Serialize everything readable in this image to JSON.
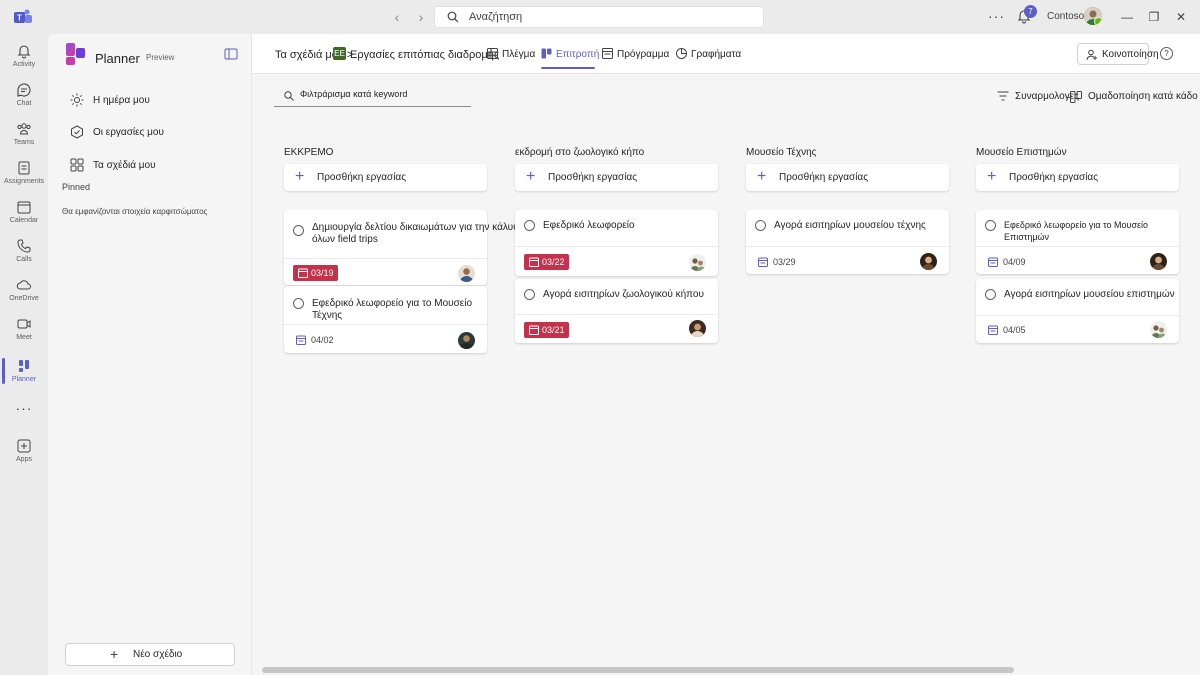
{
  "titlebar": {
    "search_placeholder": "Αναζήτηση",
    "notification_count": "7",
    "org_name": "Contoso"
  },
  "rail": {
    "items": [
      {
        "label": "Activity",
        "icon": "bell-icon"
      },
      {
        "label": "Chat",
        "icon": "chat-icon"
      },
      {
        "label": "Teams",
        "icon": "teams-icon"
      },
      {
        "label": "Assignments",
        "icon": "assignments-icon"
      },
      {
        "label": "Calendar",
        "icon": "calendar-icon"
      },
      {
        "label": "Calls",
        "icon": "phone-icon"
      },
      {
        "label": "OneDrive",
        "icon": "cloud-icon"
      },
      {
        "label": "Meet",
        "icon": "video-icon"
      },
      {
        "label": "Planner",
        "icon": "planner-icon"
      },
      {
        "label": "Apps",
        "icon": "add-apps-icon"
      }
    ],
    "more": "···"
  },
  "pane": {
    "title": "Planner",
    "preview": "Preview",
    "nav": [
      {
        "label": "Η ημέρα μου",
        "icon": "sun-icon"
      },
      {
        "label": "Οι εργασίες μου",
        "icon": "tasks-icon"
      },
      {
        "label": "Τα σχέδιά μου",
        "icon": "grid-icon"
      }
    ],
    "pinned_heading": "Pinned",
    "pinned_empty": "Θα εμφανίζονται στοιχεία καρφιτσώματος",
    "new_plan": "Νέο σχέδιο"
  },
  "header": {
    "breadcrumb": "Τα σχέδιά μου",
    "separator": ">",
    "plan_initials": "ΕΕ",
    "plan_name": "Εργασίες επιτόπιας διαδρομής",
    "tabs": [
      {
        "label": "Πλέγμα",
        "icon": "grid-view-icon",
        "active": false
      },
      {
        "label": "Επιτροπή",
        "icon": "board-view-icon",
        "active": true
      },
      {
        "label": "Πρόγραμμα",
        "icon": "schedule-view-icon",
        "active": false
      },
      {
        "label": "Γραφήματα",
        "icon": "charts-view-icon",
        "active": false
      }
    ],
    "share": "Κοινοποίηση",
    "help": "?"
  },
  "toolbar": {
    "filter_placeholder": "Φιλτράρισμα κατά keyword",
    "filter_button": "Συναρμολογ̵ες",
    "group_button": "Ομαδοποίηση κατά κάδο"
  },
  "board": {
    "add_task_label": "Προσθήκη εργασίας",
    "buckets": [
      {
        "title": "ΕΚΚΡΕΜΟ",
        "tasks": [
          {
            "title": "Δημιουργία δελτίου δικαιωμάτων για την κάλυψη όλων field trips",
            "due": "03/19",
            "late": true,
            "avatar": "avatar-male-1"
          },
          {
            "title": "Εφεδρικό λεωφορείο για το Μουσείο Τέχνης",
            "due": "04/02",
            "late": false,
            "avatar": "avatar-male-2"
          }
        ]
      },
      {
        "title": "εκδρομή στο ζωολογικό κήπο",
        "tasks": [
          {
            "title": "Εφεδρικό λεωφορείο",
            "due": "03/22",
            "late": true,
            "avatar": "avatar-group"
          },
          {
            "title": "Αγορά εισιτηρίων ζωολογικού κήπου",
            "due": "03/21",
            "late": true,
            "avatar": "avatar-female-1"
          }
        ]
      },
      {
        "title": "Μουσείο Τέχνης",
        "tasks": [
          {
            "title": "Αγορά εισιτηρίων μουσείου τέχνης",
            "due": "03/29",
            "late": false,
            "avatar": "avatar-female-2"
          }
        ]
      },
      {
        "title": "Μουσείο Επιστημών",
        "tasks": [
          {
            "title": "Εφεδρικό λεωφορείο για το Μουσείο Επιστημών",
            "due": "04/09",
            "late": false,
            "avatar": "avatar-female-2"
          },
          {
            "title": "Αγορά εισιτηρίων μουσείου επιστημών",
            "due": "04/05",
            "late": false,
            "avatar": "avatar-group"
          }
        ]
      }
    ]
  },
  "colors": {
    "accent": "#5b5fc7",
    "late": "#c4314b",
    "background": "#f5f5f5"
  }
}
